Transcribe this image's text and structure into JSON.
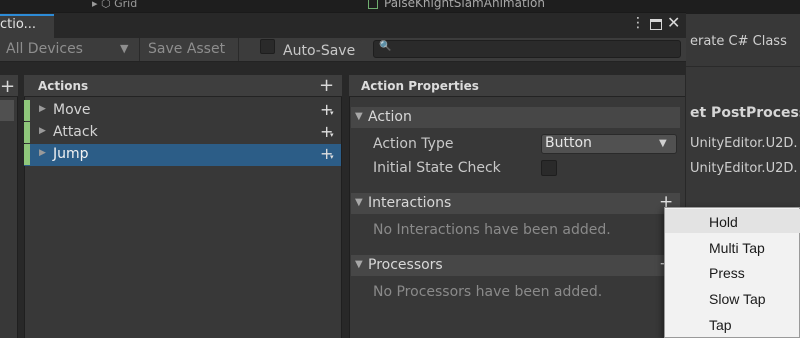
{
  "background": {
    "tree_item": "Grid",
    "animation_item": "PalseKnightSlamAnimation",
    "generate_csharp": "erate C# Class",
    "postprocess_title": "et PostProcesso",
    "unity_line1": "UnityEditor.U2D.",
    "unity_line2": "UnityEditor.U2D."
  },
  "window": {
    "tab_title": "ctio...",
    "menu_icon": "⋮",
    "close_icon": "✕"
  },
  "toolbar": {
    "devices_label": "All Devices",
    "devices_arrow": "▼",
    "save_asset_label": "Save Asset",
    "autosave_label": "Auto-Save",
    "search_icon": "🔍",
    "search_value": ""
  },
  "action_maps": {
    "add_icon": "+"
  },
  "actions": {
    "title": "Actions",
    "add_icon": "+",
    "items": [
      {
        "label": "Move",
        "selected": false
      },
      {
        "label": "Attack",
        "selected": false
      },
      {
        "label": "Jump",
        "selected": true
      }
    ],
    "row_add_icon": "+",
    "row_add_dropdown": "▾",
    "expand_icon": "▶",
    "stripe_color": "#8fc77b",
    "selection_color": "#2c5d87"
  },
  "properties": {
    "title": "Action Properties",
    "collapse_icon": "▼",
    "action_section": "Action",
    "action_type_label": "Action Type",
    "action_type_value": "Button",
    "action_type_arrow": "▼",
    "initial_state_label": "Initial State Check",
    "interactions_section": "Interactions",
    "interactions_add": "+",
    "interactions_empty": "No Interactions have been added.",
    "processors_section": "Processors",
    "processors_add": "+",
    "processors_empty": "No Processors have been added."
  },
  "dropdown_menu": {
    "items": [
      "Hold",
      "Multi Tap",
      "Press",
      "Slow Tap",
      "Tap"
    ],
    "highlighted": "Hold"
  }
}
